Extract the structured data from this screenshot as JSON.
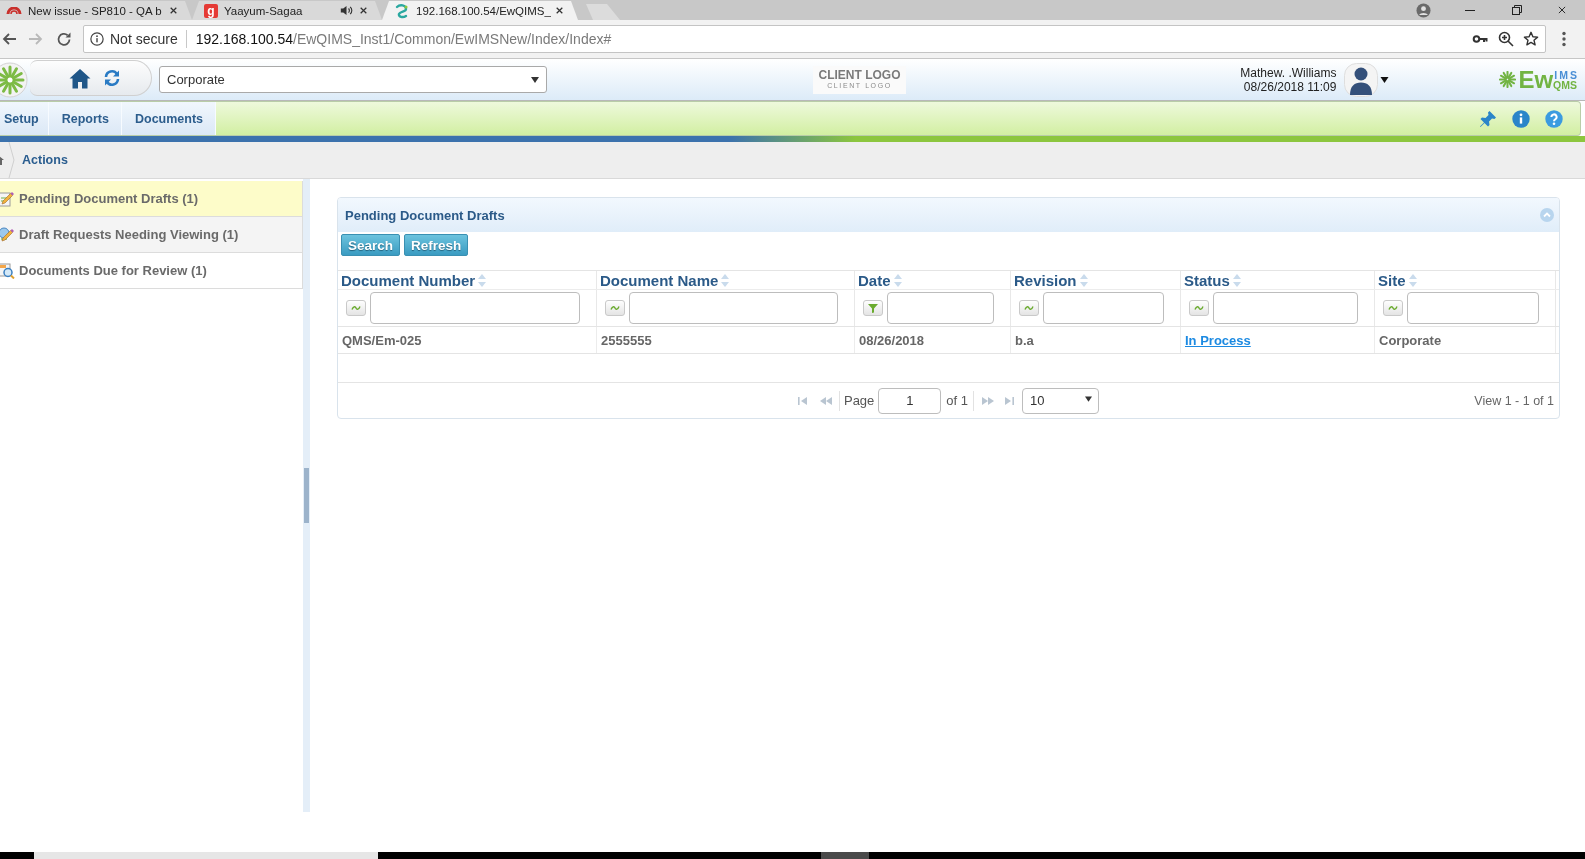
{
  "browser": {
    "tabs": [
      {
        "title": "New issue - SP810 - QA b",
        "favicon": {
          "kind": "arch"
        },
        "audio": false,
        "selected": false
      },
      {
        "title": "Yaayum-Sagaa",
        "favicon": {
          "kind": "letter",
          "text": "g"
        },
        "audio": true,
        "selected": false
      },
      {
        "title": "192.168.100.54/EwQIMS_",
        "favicon": {
          "kind": "swirl"
        },
        "audio": false,
        "selected": true
      }
    ],
    "navigation": {
      "back": {
        "disabled": false
      },
      "forward": {
        "disabled": true
      }
    },
    "address": {
      "security": "Not secure",
      "host": "192.168.100.54",
      "path": "/EwQIMS_Inst1/Common/EwIMSNew/Index/Index#"
    }
  },
  "header": {
    "site_select": {
      "value": "Corporate"
    },
    "client_logo": {
      "title": "CLIENT LOGO",
      "subtitle": "CLIENT LOGO"
    },
    "user": {
      "name": "Mathew. .Williams",
      "datetime": "08/26/2018 11:09"
    },
    "product_logo": {
      "main": "Ew",
      "upper": "IMS",
      "lower": "QMS"
    }
  },
  "menu": {
    "items": [
      {
        "label": "Setup"
      },
      {
        "label": "Reports"
      },
      {
        "label": "Documents"
      }
    ]
  },
  "breadcrumb": {
    "items": [
      {
        "label": "Actions"
      }
    ]
  },
  "sidebar": {
    "items": [
      {
        "label": "Pending Document Drafts (1)",
        "kind": "draft",
        "selected": true
      },
      {
        "label": "Draft Requests Needing Viewing (1)",
        "kind": "request",
        "selected": false
      },
      {
        "label": "Documents Due for Review (1)",
        "kind": "review",
        "selected": false
      }
    ]
  },
  "panel": {
    "title": "Pending Document Drafts",
    "buttons": [
      {
        "label": "Search"
      },
      {
        "label": "Refresh"
      }
    ],
    "table": {
      "columns": [
        {
          "label": "Document Number",
          "kind": "text"
        },
        {
          "label": "Document Name",
          "kind": "text"
        },
        {
          "label": "Date",
          "kind": "date"
        },
        {
          "label": "Revision",
          "kind": "text"
        },
        {
          "label": "Status",
          "kind": "text"
        },
        {
          "label": "Site",
          "kind": "text"
        }
      ],
      "rows": [
        {
          "cells": [
            {
              "kind": "text",
              "text": "QMS/Em-025"
            },
            {
              "kind": "text",
              "text": "2555555"
            },
            {
              "kind": "text",
              "text": "08/26/2018"
            },
            {
              "kind": "text",
              "text": "b.a"
            },
            {
              "kind": "link",
              "text": "In Process"
            },
            {
              "kind": "text",
              "text": "Corporate"
            }
          ]
        }
      ]
    },
    "pager": {
      "page_label": "Page",
      "page": "1",
      "page_count": "of 1",
      "page_size": "10",
      "summary": "View 1 - 1 of 1"
    }
  }
}
